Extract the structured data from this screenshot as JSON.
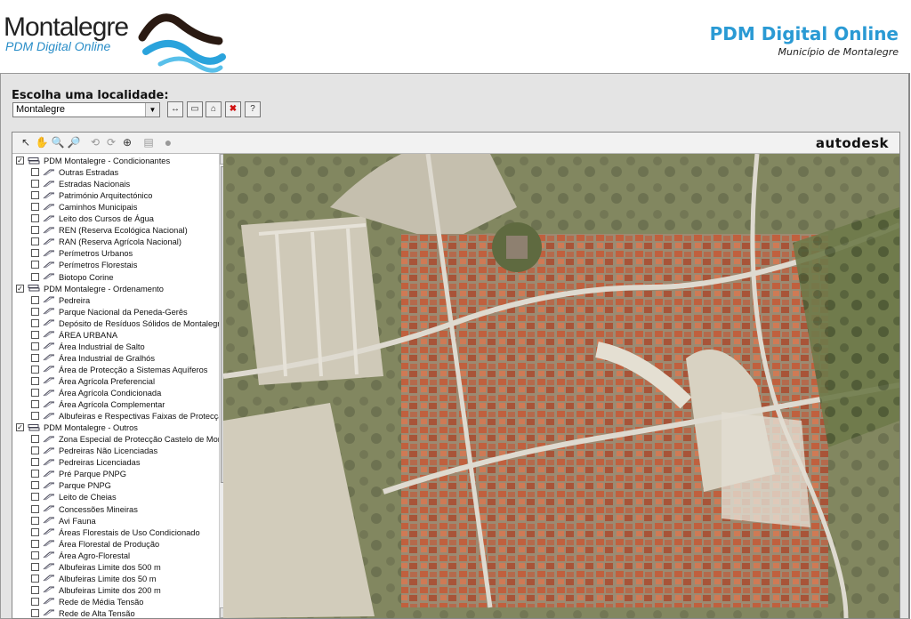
{
  "header": {
    "logo_name": "Montalegre",
    "logo_subtitle": "PDM Digital Online",
    "site_title": "PDM Digital Online",
    "site_subtitle": "Município de Montalegre"
  },
  "location": {
    "label": "Escolha uma localidade:",
    "selected": "Montalegre",
    "buttons": [
      "ruler-icon",
      "frame-icon",
      "home-icon",
      "close-icon",
      "help-icon"
    ]
  },
  "viewer": {
    "brand": "autodesk",
    "tools": [
      "select-icon",
      "pan-icon",
      "zoom-in-icon",
      "zoom-out-icon",
      "zoom-previous-icon",
      "zoom-next-icon",
      "zoom-window-icon",
      "print-icon",
      "refresh-icon"
    ]
  },
  "layers": [
    {
      "label": "PDM Montalegre - Condicionantes",
      "group": true,
      "checked": true
    },
    {
      "label": "Outras Estradas"
    },
    {
      "label": "Estradas Nacionais"
    },
    {
      "label": "Património Arquitectónico"
    },
    {
      "label": "Caminhos Municipais"
    },
    {
      "label": "Leito dos Cursos de Água"
    },
    {
      "label": "REN (Reserva Ecológica Nacional)"
    },
    {
      "label": "RAN (Reserva Agrícola Nacional)"
    },
    {
      "label": "Perímetros Urbanos"
    },
    {
      "label": "Perímetros Florestais"
    },
    {
      "label": "Biotopo Corine"
    },
    {
      "label": "PDM Montalegre - Ordenamento",
      "group": true,
      "checked": true
    },
    {
      "label": "Pedreira"
    },
    {
      "label": "Parque Nacional da Peneda-Gerês"
    },
    {
      "label": "Depósito de Resíduos Sólidos de Montalegre"
    },
    {
      "label": "ÁREA URBANA"
    },
    {
      "label": "Área Industrial de Salto"
    },
    {
      "label": "Área Industrial de Gralhós"
    },
    {
      "label": "Área de Protecção a Sistemas Aquíferos"
    },
    {
      "label": "Área Agrícola Preferencial"
    },
    {
      "label": "Área Agrícola Condicionada"
    },
    {
      "label": "Área Agrícola Complementar"
    },
    {
      "label": "Albufeiras e Respectivas Faixas de Protecção"
    },
    {
      "label": "PDM Montalegre - Outros",
      "group": true,
      "checked": true
    },
    {
      "label": "Zona Especial de Protecção Castelo de Montalegre"
    },
    {
      "label": "Pedreiras Não Licenciadas"
    },
    {
      "label": "Pedreiras Licenciadas"
    },
    {
      "label": "Pré Parque PNPG"
    },
    {
      "label": "Parque PNPG"
    },
    {
      "label": "Leito de Cheias"
    },
    {
      "label": "Concessões Mineiras"
    },
    {
      "label": "Avi Fauna"
    },
    {
      "label": "Áreas Florestais de Uso Condicionado"
    },
    {
      "label": "Área Florestal de Produção"
    },
    {
      "label": "Área Agro-Florestal"
    },
    {
      "label": "Albufeiras Limite dos 500 m"
    },
    {
      "label": "Albufeiras Limite dos 50 m"
    },
    {
      "label": "Albufeiras Limite dos 200 m"
    },
    {
      "label": "Rede de Média Tensão"
    },
    {
      "label": "Rede de Alta Tensão"
    }
  ]
}
